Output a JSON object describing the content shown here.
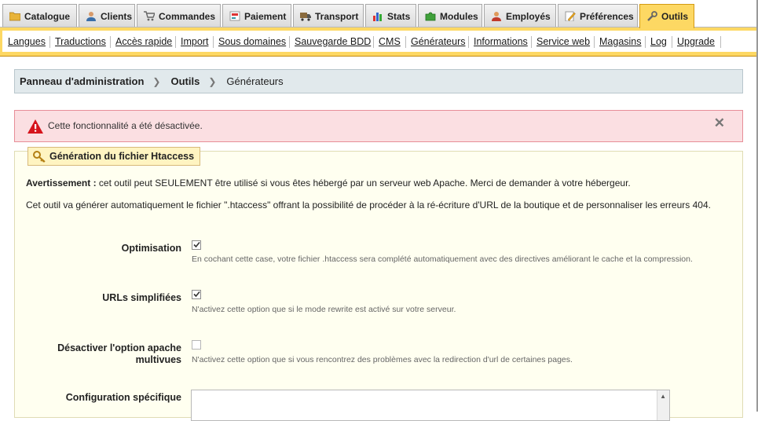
{
  "tabs": [
    {
      "label": "Catalogue",
      "icon": "folder-icon"
    },
    {
      "label": "Clients",
      "icon": "user-icon"
    },
    {
      "label": "Commandes",
      "icon": "cart-icon"
    },
    {
      "label": "Paiement",
      "icon": "payment-icon"
    },
    {
      "label": "Transport",
      "icon": "truck-icon"
    },
    {
      "label": "Stats",
      "icon": "chart-icon"
    },
    {
      "label": "Modules",
      "icon": "puzzle-icon"
    },
    {
      "label": "Employés",
      "icon": "employee-icon"
    },
    {
      "label": "Préférences",
      "icon": "preferences-icon"
    },
    {
      "label": "Outils",
      "icon": "tools-icon",
      "active": true
    }
  ],
  "subnav": [
    "Langues",
    "Traductions",
    "Accès rapide",
    "Import",
    "Sous domaines",
    "Sauvegarde BDD",
    "CMS",
    "Générateurs",
    "Informations",
    "Service web",
    "Magasins",
    "Log",
    "Upgrade"
  ],
  "breadcrumb": {
    "root": "Panneau d'administration",
    "section": "Outils",
    "current": "Générateurs"
  },
  "error": {
    "message": "Cette fonctionnalité a été désactivée.",
    "close": "✕"
  },
  "panel": {
    "legend": "Génération du fichier Htaccess",
    "warning_strong": "Avertissement :",
    "warning_text": " cet outil peut SEULEMENT être utilisé si vous êtes hébergé par un serveur web Apache. Merci de demander à votre hébergeur.",
    "info": "Cet outil va générer automatiquement le fichier \".htaccess\" offrant la possibilité de procéder à la ré-écriture d'URL de la boutique et de personnaliser les erreurs 404.",
    "options": [
      {
        "label": "Optimisation",
        "checked": true,
        "hint": "En cochant cette case, votre fichier .htaccess sera complété automatiquement avec des directives améliorant le cache et la compression."
      },
      {
        "label": "URLs simplifiées",
        "checked": true,
        "hint": "N'activez cette option que si le mode rewrite est activé sur votre serveur."
      },
      {
        "label": "Désactiver l'option apache multivues",
        "checked": false,
        "hint": "N'activez cette option que si vous rencontrez des problèmes avec la redirection d'url de certaines pages."
      }
    ],
    "specific_label": "Configuration spécifique"
  },
  "colors": {
    "active_tab": "#fdd863",
    "error_bg": "#fbdfe2",
    "panel_bg": "#fffff0",
    "breadcrumb_bg": "#e1e9ec"
  }
}
